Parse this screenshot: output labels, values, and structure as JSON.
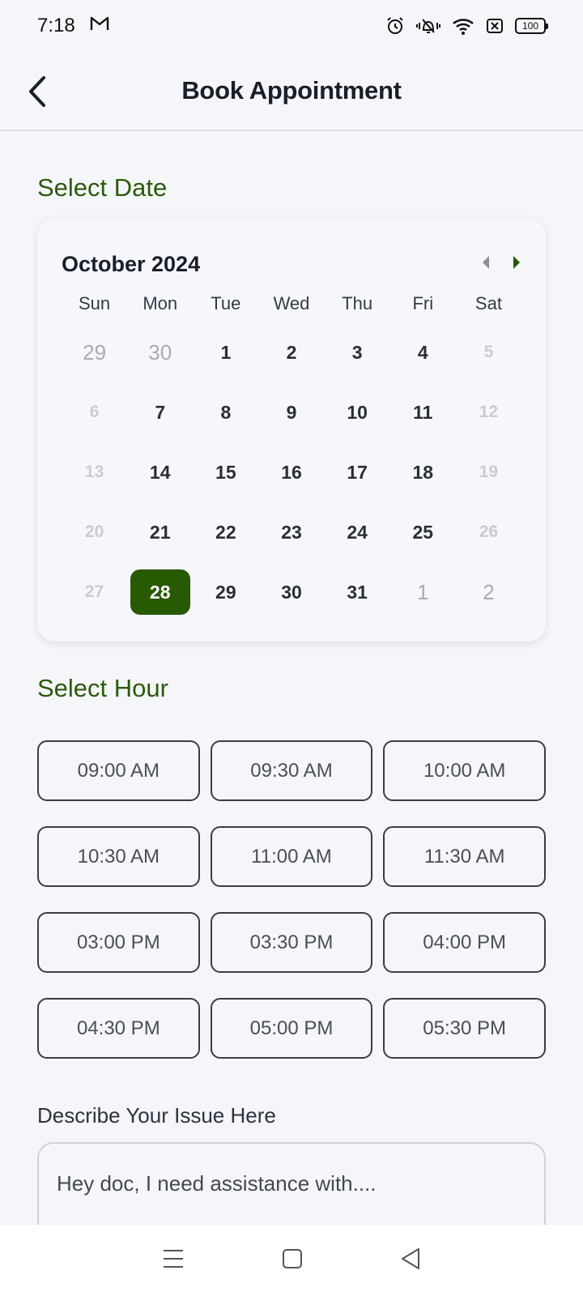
{
  "status_bar": {
    "time": "7:18",
    "battery": "100",
    "icons": [
      "gmail-icon",
      "alarm-icon",
      "vibrate-icon",
      "wifi-icon",
      "sim-off-icon",
      "battery-icon"
    ]
  },
  "header": {
    "title": "Book Appointment"
  },
  "date_section": {
    "title": "Select Date"
  },
  "calendar": {
    "month_label": "October 2024",
    "weekdays": [
      "Sun",
      "Mon",
      "Tue",
      "Wed",
      "Thu",
      "Fri",
      "Sat"
    ],
    "days": [
      {
        "label": "29",
        "state": "outside"
      },
      {
        "label": "30",
        "state": "outside"
      },
      {
        "label": "1",
        "state": "normal"
      },
      {
        "label": "2",
        "state": "normal"
      },
      {
        "label": "3",
        "state": "normal"
      },
      {
        "label": "4",
        "state": "normal"
      },
      {
        "label": "5",
        "state": "weekend"
      },
      {
        "label": "6",
        "state": "weekend"
      },
      {
        "label": "7",
        "state": "normal"
      },
      {
        "label": "8",
        "state": "normal"
      },
      {
        "label": "9",
        "state": "normal"
      },
      {
        "label": "10",
        "state": "normal"
      },
      {
        "label": "11",
        "state": "normal"
      },
      {
        "label": "12",
        "state": "weekend"
      },
      {
        "label": "13",
        "state": "weekend"
      },
      {
        "label": "14",
        "state": "normal"
      },
      {
        "label": "15",
        "state": "normal"
      },
      {
        "label": "16",
        "state": "normal"
      },
      {
        "label": "17",
        "state": "normal"
      },
      {
        "label": "18",
        "state": "normal"
      },
      {
        "label": "19",
        "state": "weekend"
      },
      {
        "label": "20",
        "state": "weekend"
      },
      {
        "label": "21",
        "state": "normal"
      },
      {
        "label": "22",
        "state": "normal"
      },
      {
        "label": "23",
        "state": "normal"
      },
      {
        "label": "24",
        "state": "normal"
      },
      {
        "label": "25",
        "state": "normal"
      },
      {
        "label": "26",
        "state": "weekend"
      },
      {
        "label": "27",
        "state": "weekend"
      },
      {
        "label": "28",
        "state": "selected"
      },
      {
        "label": "29",
        "state": "normal"
      },
      {
        "label": "30",
        "state": "normal"
      },
      {
        "label": "31",
        "state": "normal"
      },
      {
        "label": "1",
        "state": "outside"
      },
      {
        "label": "2",
        "state": "outside"
      }
    ],
    "selected_color": "#275a03"
  },
  "hour_section": {
    "title": "Select Hour",
    "slots": [
      "09:00 AM",
      "09:30 AM",
      "10:00 AM",
      "10:30 AM",
      "11:00 AM",
      "11:30 AM",
      "03:00 PM",
      "03:30 PM",
      "04:00 PM",
      "04:30 PM",
      "05:00 PM",
      "05:30 PM"
    ]
  },
  "issue": {
    "label": "Describe Your Issue Here",
    "value": "Hey doc, I need assistance with...."
  },
  "colors": {
    "accent": "#2c5a0c",
    "background": "#f5f6fa"
  }
}
